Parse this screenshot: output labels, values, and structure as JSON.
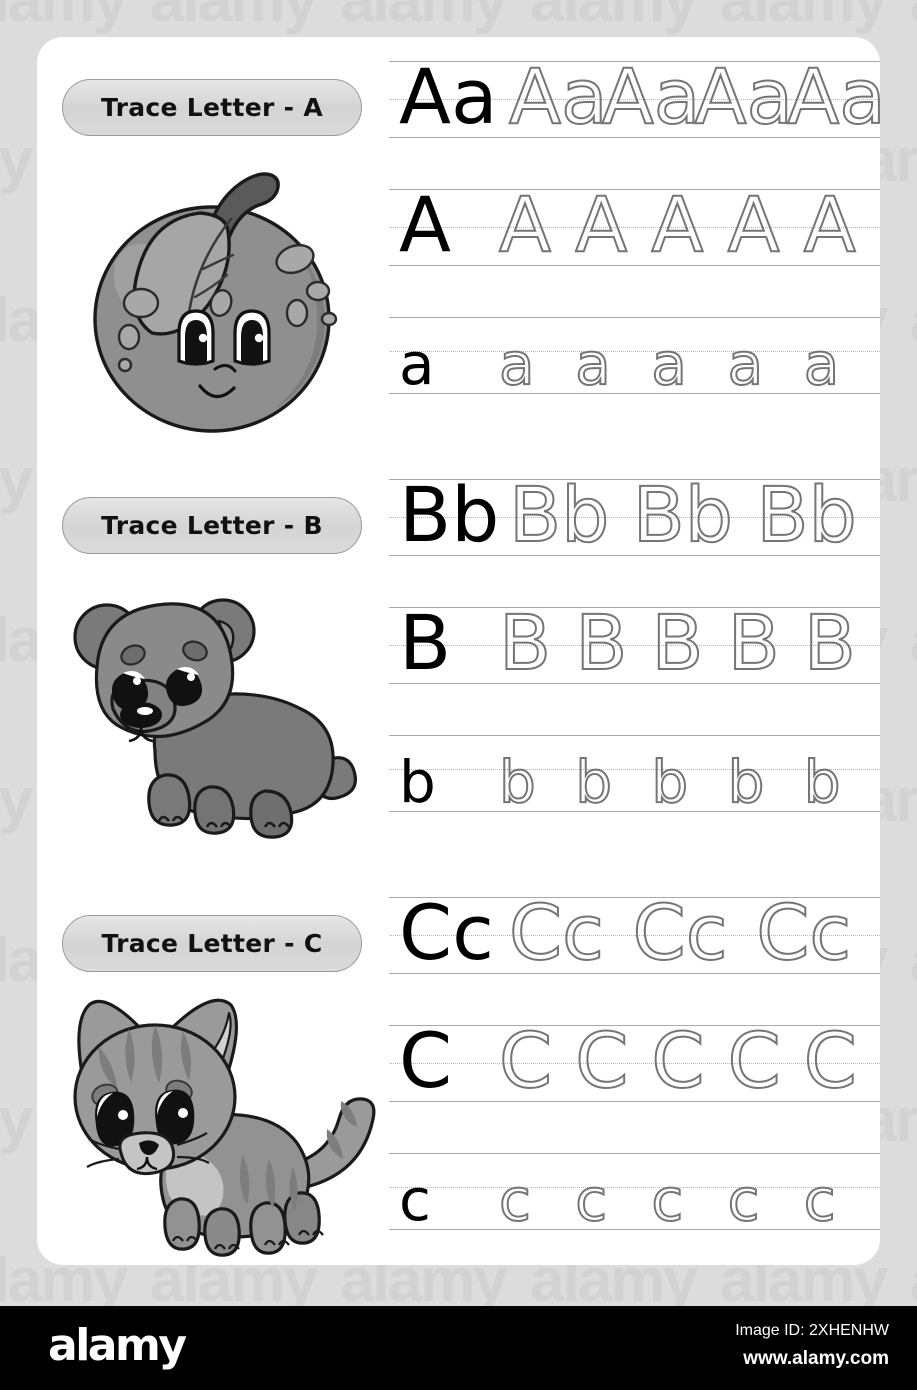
{
  "page": {
    "background_color": "#dcdcdc",
    "sheet_color": "#ffffff",
    "watermark_text": "alamy"
  },
  "sections": [
    {
      "id": "a",
      "title": "Trace Letter - A",
      "animal": "apple",
      "animal_label": "smiling-apple-illustration",
      "rows": [
        {
          "model": "Aa",
          "repeat": "Aa",
          "repeat_count": 4,
          "kind": "mixed"
        },
        {
          "model": "A",
          "repeat": "A",
          "repeat_count": 5,
          "kind": "uppercase"
        },
        {
          "model": "a",
          "repeat": "a",
          "repeat_count": 5,
          "kind": "lowercase"
        }
      ]
    },
    {
      "id": "b",
      "title": "Trace Letter - B",
      "animal": "bear",
      "animal_label": "bear-cub-illustration",
      "rows": [
        {
          "model": "Bb",
          "repeat": "Bb",
          "repeat_count": 3,
          "kind": "mixed"
        },
        {
          "model": "B",
          "repeat": "B",
          "repeat_count": 5,
          "kind": "uppercase"
        },
        {
          "model": "b",
          "repeat": "b",
          "repeat_count": 5,
          "kind": "lowercase"
        }
      ]
    },
    {
      "id": "c",
      "title": "Trace Letter - C",
      "animal": "cat",
      "animal_label": "kitten-illustration",
      "rows": [
        {
          "model": "Cc",
          "repeat": "Cc",
          "repeat_count": 3,
          "kind": "mixed"
        },
        {
          "model": "C",
          "repeat": "C",
          "repeat_count": 5,
          "kind": "uppercase"
        },
        {
          "model": "c",
          "repeat": "c",
          "repeat_count": 5,
          "kind": "lowercase"
        }
      ]
    }
  ],
  "footer": {
    "logo": "alamy",
    "image_id": "Image ID: 2XHENHW",
    "website": "www.alamy.com"
  },
  "colors": {
    "rule_line": "#a9a9a9",
    "mid_line": "#b4b4b4",
    "trace_dashed": "#6e6e6e",
    "trace_solid": "#000000",
    "pill_border": "#9a9a9a",
    "pill_fill": "#dadada"
  }
}
